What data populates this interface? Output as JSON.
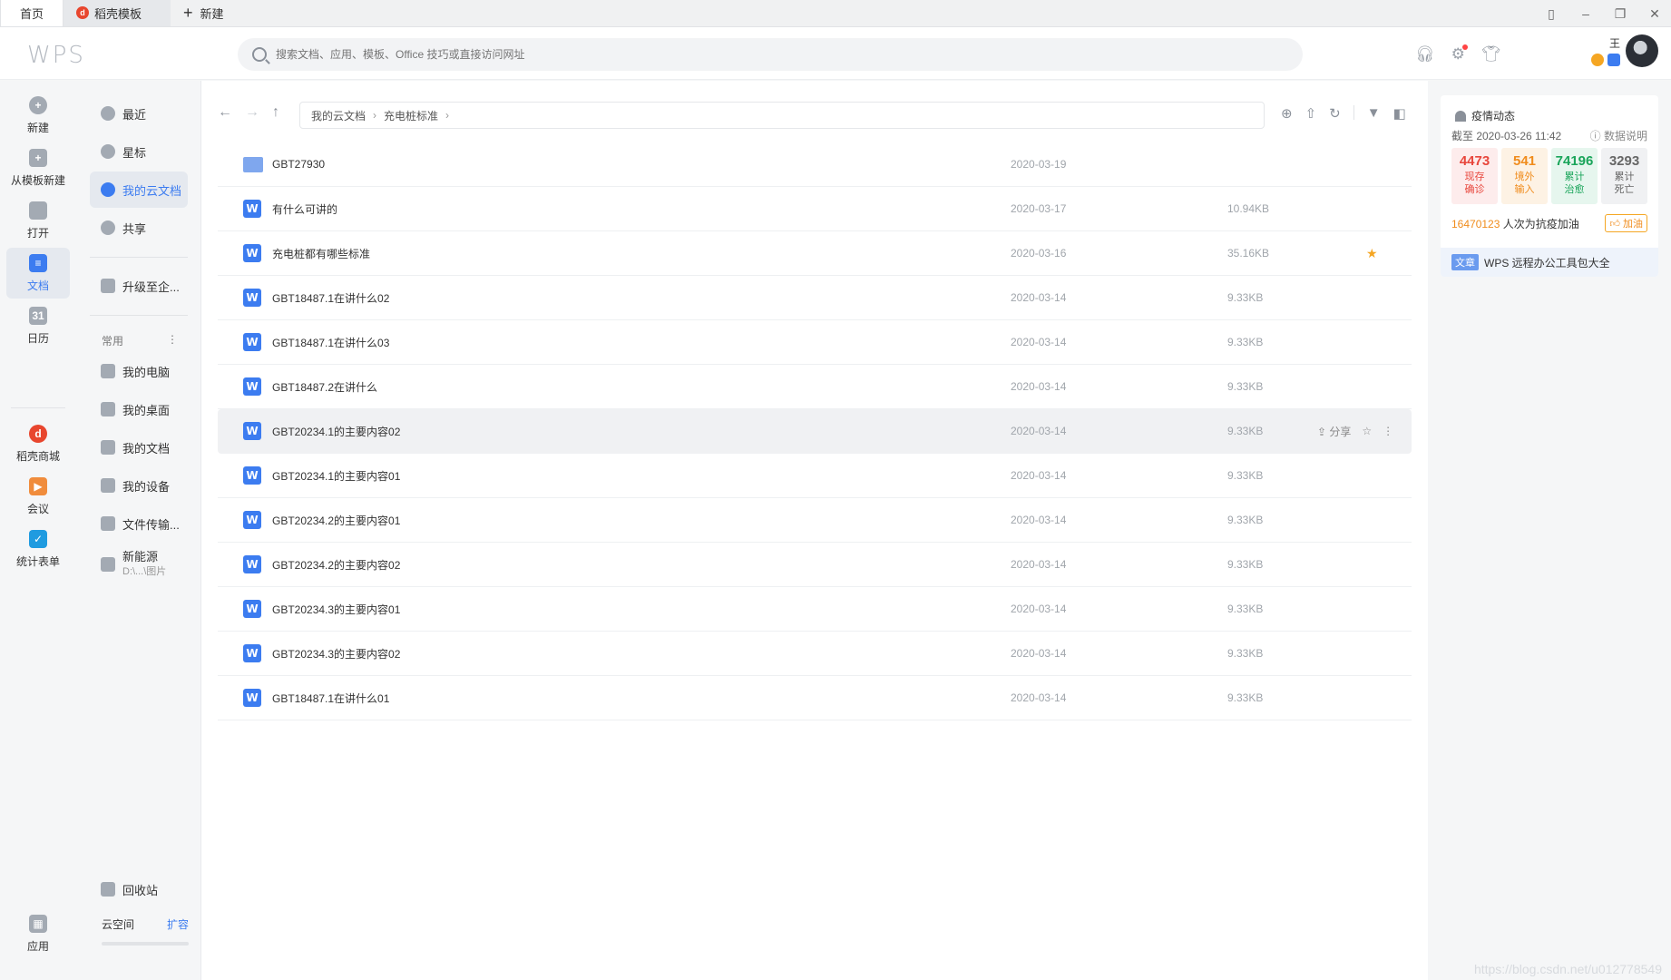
{
  "tabs": {
    "home": "首页",
    "template": "稻壳模板",
    "new": "新建"
  },
  "header": {
    "logo": "WPS",
    "search_placeholder": "搜索文档、应用、模板、Office 技巧或直接访问网址",
    "user_initial": "王"
  },
  "rail": {
    "items": [
      {
        "label": "新建",
        "icon": "plus-icon"
      },
      {
        "label": "从模板新建",
        "icon": "template-icon"
      },
      {
        "label": "打开",
        "icon": "folder-open-icon"
      },
      {
        "label": "文档",
        "icon": "document-icon"
      },
      {
        "label": "日历",
        "icon": "calendar-icon",
        "glyph": "31"
      },
      {
        "label": "稻壳商城",
        "icon": "docer-store-icon"
      },
      {
        "label": "会议",
        "icon": "meeting-icon"
      },
      {
        "label": "统计表单",
        "icon": "form-icon"
      },
      {
        "label": "应用",
        "icon": "apps-icon"
      }
    ]
  },
  "sidebar": {
    "items": [
      {
        "label": "最近"
      },
      {
        "label": "星标"
      },
      {
        "label": "我的云文档"
      },
      {
        "label": "共享"
      },
      {
        "label": "升级至企..."
      }
    ],
    "group_label": "常用",
    "group_more": "⋮",
    "common": [
      {
        "label": "我的电脑"
      },
      {
        "label": "我的桌面"
      },
      {
        "label": "我的文档"
      },
      {
        "label": "我的设备"
      },
      {
        "label": "文件传输..."
      },
      {
        "label": "新能源",
        "sub": "D:\\...\\图片"
      }
    ],
    "trash": "回收站",
    "cloud_space": "云空间",
    "expand": "扩容"
  },
  "breadcrumb": [
    "我的云文档",
    "充电桩标准"
  ],
  "files": [
    {
      "type": "folder",
      "name": "GBT27930",
      "date": "2020-03-19",
      "size": "",
      "starred": false
    },
    {
      "type": "doc",
      "name": "有什么可讲的",
      "date": "2020-03-17",
      "size": "10.94KB",
      "starred": false
    },
    {
      "type": "doc",
      "name": "充电桩都有哪些标准",
      "date": "2020-03-16",
      "size": "35.16KB",
      "starred": true
    },
    {
      "type": "doc",
      "name": "GBT18487.1在讲什么02",
      "date": "2020-03-14",
      "size": "9.33KB",
      "starred": false
    },
    {
      "type": "doc",
      "name": "GBT18487.1在讲什么03",
      "date": "2020-03-14",
      "size": "9.33KB",
      "starred": false
    },
    {
      "type": "doc",
      "name": "GBT18487.2在讲什么",
      "date": "2020-03-14",
      "size": "9.33KB",
      "starred": false
    },
    {
      "type": "doc",
      "name": "GBT20234.1的主要内容02",
      "date": "2020-03-14",
      "size": "9.33KB",
      "starred": false,
      "hover": true
    },
    {
      "type": "doc",
      "name": "GBT20234.1的主要内容01",
      "date": "2020-03-14",
      "size": "9.33KB",
      "starred": false
    },
    {
      "type": "doc",
      "name": "GBT20234.2的主要内容01",
      "date": "2020-03-14",
      "size": "9.33KB",
      "starred": false
    },
    {
      "type": "doc",
      "name": "GBT20234.2的主要内容02",
      "date": "2020-03-14",
      "size": "9.33KB",
      "starred": false
    },
    {
      "type": "doc",
      "name": "GBT20234.3的主要内容01",
      "date": "2020-03-14",
      "size": "9.33KB",
      "starred": false
    },
    {
      "type": "doc",
      "name": "GBT20234.3的主要内容02",
      "date": "2020-03-14",
      "size": "9.33KB",
      "starred": false
    },
    {
      "type": "doc",
      "name": "GBT18487.1在讲什么01",
      "date": "2020-03-14",
      "size": "9.33KB",
      "starred": false
    }
  ],
  "row_actions": {
    "share": "分享"
  },
  "epidemic": {
    "title": "疫情动态",
    "as_of": "截至 2020-03-26 11:42",
    "explain": "数据说明",
    "stats": [
      {
        "num": "4473",
        "label": "现存确诊"
      },
      {
        "num": "541",
        "label": "境外输入"
      },
      {
        "num": "74196",
        "label": "累计治愈"
      },
      {
        "num": "3293",
        "label": "累计死亡"
      }
    ],
    "cheer_num": "16470123",
    "cheer_text": "人次为抗疫加油",
    "cheer_btn": "加油",
    "promo_tag": "文章",
    "promo_text": "WPS 远程办公工具包大全"
  },
  "watermark": "https://blog.csdn.net/u012778549"
}
